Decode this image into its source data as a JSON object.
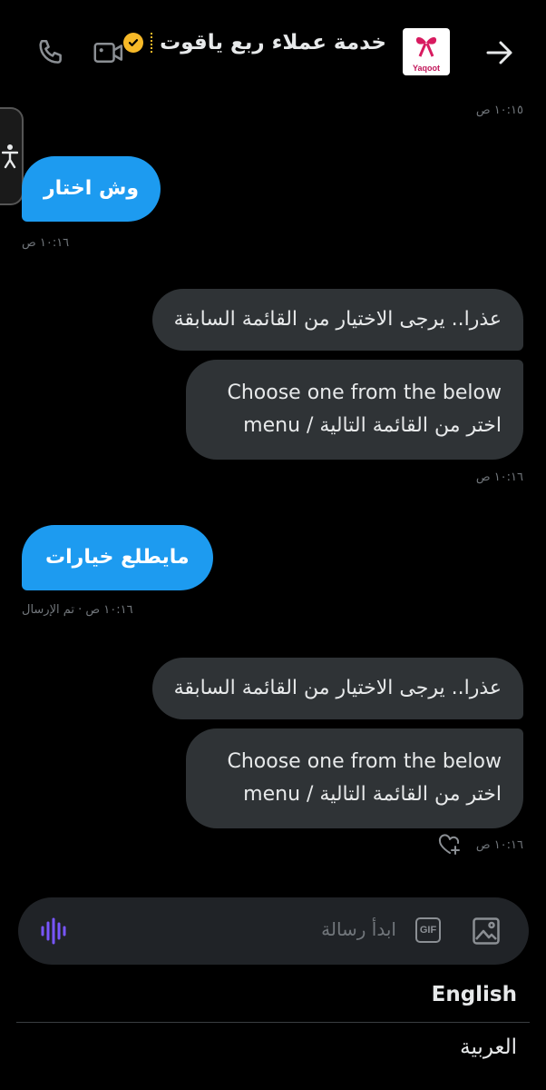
{
  "header": {
    "title": "خدمة عملاء ربع ياقوت",
    "logo_text": "Yaqoot"
  },
  "messages": [
    {
      "time": "١٠:١٥ ص"
    },
    {
      "text": "وش اختار",
      "time": "١٠:١٦ ص"
    },
    {
      "text": "عذرا.. يرجى الاختيار من القائمة السابقة"
    },
    {
      "line1": "Choose one from the below",
      "line2": "menu / اختر من القائمة التالية",
      "time": "١٠:١٦ ص"
    },
    {
      "text": "مايطلع خيارات",
      "time": "١٠:١٦ ص · تم الإرسال"
    },
    {
      "text": "عذرا.. يرجى الاختيار من القائمة السابقة"
    },
    {
      "line1": "Choose one from the below",
      "line2": "menu / اختر من القائمة التالية",
      "time": "١٠:١٦ ص"
    }
  ],
  "composer": {
    "placeholder": "ابدأ رسالة",
    "gif_label": "GIF"
  },
  "keyboard_languages": [
    "English",
    "العربية"
  ],
  "colors": {
    "accent": "#1d9bf0",
    "incoming_bubble": "#2f3336",
    "background": "#000000",
    "voice_icon": "#7856ff"
  }
}
